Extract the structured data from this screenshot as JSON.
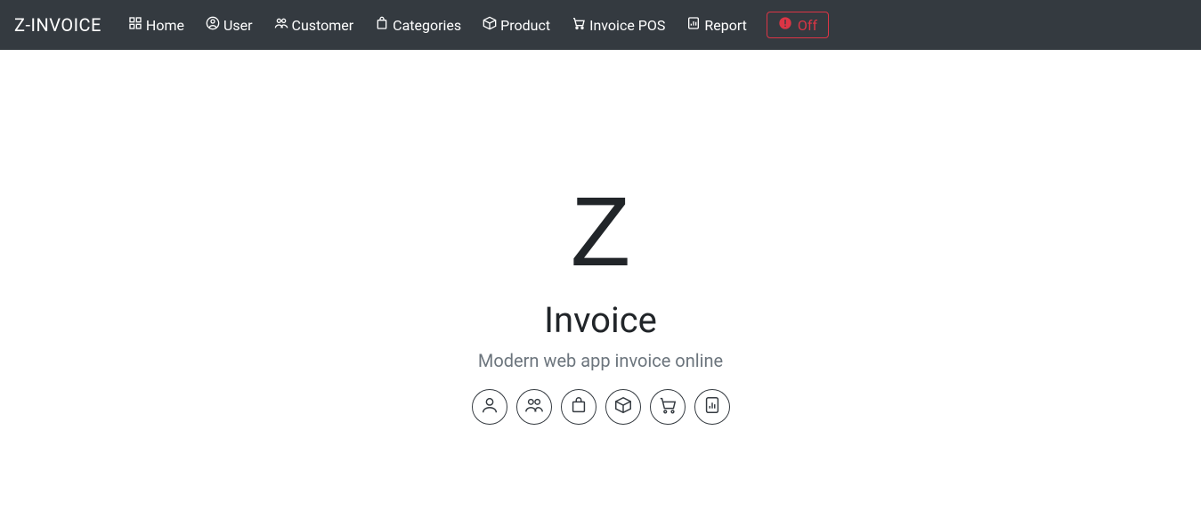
{
  "brand": "Z-INVOICE",
  "nav": {
    "home": "Home",
    "user": "User",
    "customer": "Customer",
    "categories": "Categories",
    "product": "Product",
    "invoice_pos": "Invoice POS",
    "report": "Report",
    "off": "Off"
  },
  "hero": {
    "logo_letter": "Z",
    "title": "Invoice",
    "subtitle": "Modern web app invoice online"
  }
}
